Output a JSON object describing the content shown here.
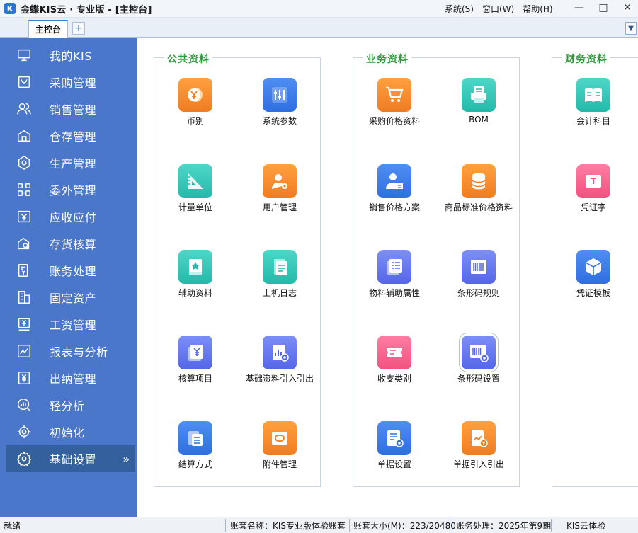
{
  "window": {
    "title": "金蝶KIS云 · 专业版 - [主控台]",
    "logo_glyph": "K"
  },
  "menu": {
    "system": "系统(S)",
    "window": "窗口(W)",
    "help": "帮助(H)"
  },
  "window_controls": {
    "minimize": "—",
    "maximize": "□",
    "close": "✕"
  },
  "tabs": {
    "main": "主控台",
    "add": "+",
    "dropdown": "▼"
  },
  "sidebar": {
    "items": [
      {
        "label": "我的KIS",
        "icon": "monitor-icon"
      },
      {
        "label": "采购管理",
        "icon": "purchase-bag-icon"
      },
      {
        "label": "销售管理",
        "icon": "people-icon"
      },
      {
        "label": "仓存管理",
        "icon": "warehouse-icon"
      },
      {
        "label": "生产管理",
        "icon": "production-hex-icon"
      },
      {
        "label": "委外管理",
        "icon": "outsource-icon"
      },
      {
        "label": "应收应付",
        "icon": "yen-card-icon"
      },
      {
        "label": "存货核算",
        "icon": "inventory-search-icon"
      },
      {
        "label": "账务处理",
        "icon": "ledger-yen-icon"
      },
      {
        "label": "固定资产",
        "icon": "building-icon"
      },
      {
        "label": "工资管理",
        "icon": "salary-icon"
      },
      {
        "label": "报表与分析",
        "icon": "chart-icon"
      },
      {
        "label": "出纳管理",
        "icon": "cashier-icon"
      },
      {
        "label": "轻分析",
        "icon": "light-analysis-icon"
      },
      {
        "label": "初始化",
        "icon": "init-target-icon"
      },
      {
        "label": "基础设置",
        "icon": "gear-icon"
      }
    ],
    "active_arrow": "»"
  },
  "groups": {
    "public": {
      "title": "公共资料",
      "tiles": [
        {
          "label": "币别",
          "icon": "currency-icon",
          "color": "orange"
        },
        {
          "label": "系统参数",
          "icon": "system-params-icon",
          "color": "blue"
        },
        {
          "label": "计量单位",
          "icon": "ruler-triangle-icon",
          "color": "teal"
        },
        {
          "label": "用户管理",
          "icon": "user-gear-icon",
          "color": "orange"
        },
        {
          "label": "辅助资料",
          "icon": "star-book-icon",
          "color": "teal"
        },
        {
          "label": "上机日志",
          "icon": "log-document-icon",
          "color": "teal"
        },
        {
          "label": "核算项目",
          "icon": "accounting-items-icon",
          "color": "indigo"
        },
        {
          "label": "基础资料引入引出",
          "icon": "import-export-icon",
          "color": "indigo"
        },
        {
          "label": "结算方式",
          "icon": "settlement-icon",
          "color": "blue"
        },
        {
          "label": "附件管理",
          "icon": "attachment-icon",
          "color": "orange"
        }
      ]
    },
    "business": {
      "title": "业务资料",
      "tiles": [
        {
          "label": "采购价格资料",
          "icon": "cart-icon",
          "color": "orange"
        },
        {
          "label": "BOM",
          "icon": "bom-printer-icon",
          "color": "teal"
        },
        {
          "label": "销售价格方案",
          "icon": "sales-person-icon",
          "color": "blue"
        },
        {
          "label": "商品标准价格资料",
          "icon": "database-icon",
          "color": "orange"
        },
        {
          "label": "物料辅助属性",
          "icon": "material-list-icon",
          "color": "indigo"
        },
        {
          "label": "条形码规则",
          "icon": "barcode-icon",
          "color": "indigo"
        },
        {
          "label": "收支类别",
          "icon": "ticket-icon",
          "color": "pink"
        },
        {
          "label": "条形码设置",
          "icon": "barcode-gear-icon",
          "color": "indigo"
        },
        {
          "label": "单据设置",
          "icon": "document-gear-icon",
          "color": "blue"
        },
        {
          "label": "单据引入引出",
          "icon": "document-chart-icon",
          "color": "orange"
        }
      ]
    },
    "finance": {
      "title": "财务资料",
      "tiles": [
        {
          "label": "会计科目",
          "icon": "open-book-icon",
          "color": "teal"
        },
        {
          "label": "凭证字",
          "icon": "voucher-t-icon",
          "color": "pink"
        },
        {
          "label": "凭证模板",
          "icon": "cube-icon",
          "color": "blue"
        }
      ]
    }
  },
  "status": {
    "ready": "就绪",
    "account_name": "账套名称：KIS专业版体验账套",
    "account_size": "账套大小(M)：223/20480",
    "period": "账务处理：2025年第9期",
    "edition": "KIS云体验"
  }
}
